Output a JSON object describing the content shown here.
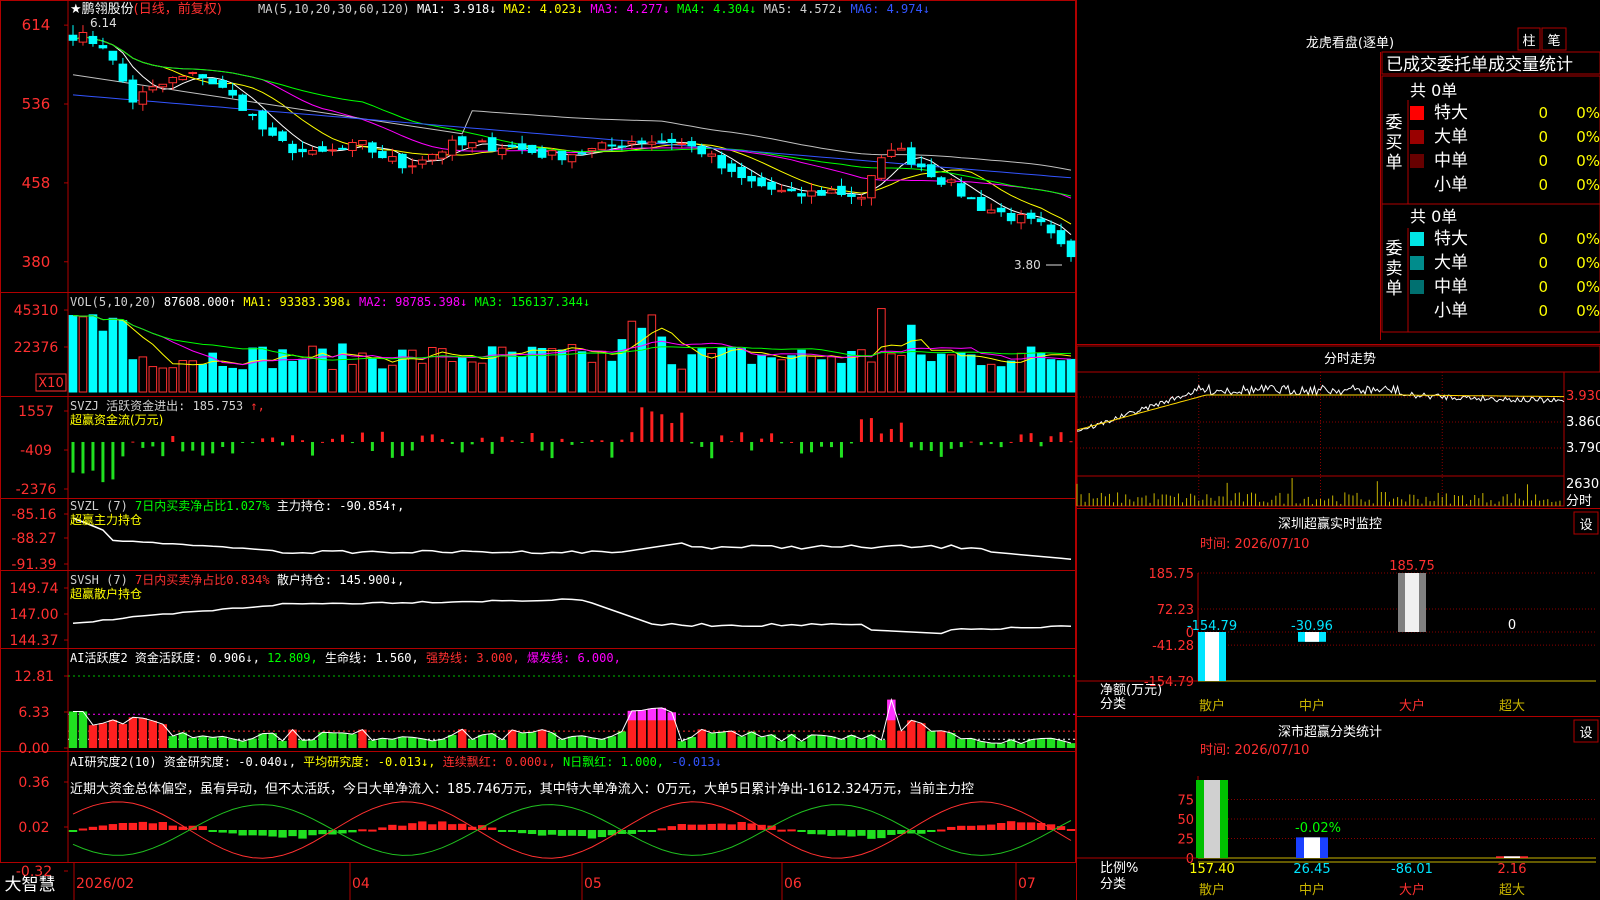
{
  "stock": {
    "title_prefix": "★",
    "name": "鹏翎股份",
    "period": "(日线，前复权)",
    "low_mark": "3.80",
    "high_mark": "6.14"
  },
  "kline": {
    "header": [
      {
        "text": "MA(5,10,20,30,60,120)",
        "color": "#d0d0d0"
      },
      {
        "text": "MA1: 3.918↓",
        "color": "#ffffff"
      },
      {
        "text": "MA2: 4.023↓",
        "color": "#ffff00"
      },
      {
        "text": "MA3: 4.277↓",
        "color": "#ff00ff"
      },
      {
        "text": "MA4: 4.304↓",
        "color": "#00ff00"
      },
      {
        "text": "MA5: 4.572↓",
        "color": "#d0d0d0"
      },
      {
        "text": "MA6: 4.974↓",
        "color": "#3355ff"
      }
    ],
    "y_ticks": [
      "614",
      "536",
      "458",
      "380"
    ],
    "ylim": [
      3.6,
      6.25
    ]
  },
  "volume": {
    "header": [
      {
        "text": "VOL(5,10,20)",
        "color": "#d0d0d0"
      },
      {
        "text": "87608.000↑",
        "color": "#ffffff"
      },
      {
        "text": "MA1: 93383.398↓",
        "color": "#ffff00"
      },
      {
        "text": "MA2: 98785.398↓",
        "color": "#ff00ff"
      },
      {
        "text": "MA3: 156137.344↓",
        "color": "#00ff00"
      }
    ],
    "y_ticks": [
      "45310",
      "22376"
    ],
    "unit": "X10"
  },
  "svzj": {
    "line1": [
      {
        "text": "SVZJ  活跃资金进出: 185.753",
        "color": "#d0d0d0"
      },
      {
        "text": "↑,",
        "color": "#ff3030"
      }
    ],
    "line2": "超赢资金流(万元)",
    "y_ticks": [
      "1557",
      "-409",
      "-2376"
    ]
  },
  "svzl": {
    "line1": [
      {
        "text": "SVZL (7)",
        "color": "#d0d0d0"
      },
      {
        "text": "7日内买卖净占比1.027%",
        "color": "#00ff00"
      },
      {
        "text": "主力持仓: -90.854↑,",
        "color": "#ffffff"
      }
    ],
    "line2": "超赢主力持仓",
    "y_ticks": [
      "-85.16",
      "-88.27",
      "-91.39"
    ]
  },
  "svsh": {
    "line1": [
      {
        "text": "SVSH (7)",
        "color": "#d0d0d0"
      },
      {
        "text": "7日内买卖净占比0.834%",
        "color": "#ff3030"
      },
      {
        "text": "散户持仓: 145.900↓,",
        "color": "#ffffff"
      }
    ],
    "line2": "超赢散户持仓",
    "y_ticks": [
      "149.74",
      "147.00",
      "144.37"
    ]
  },
  "ai1": {
    "line1": [
      {
        "text": "AI活跃度2 资金活跃度: 0.906↓,",
        "color": "#ffffff"
      },
      {
        "text": "12.809,",
        "color": "#00ff00"
      },
      {
        "text": "生命线: 1.560,",
        "color": "#ffffff"
      },
      {
        "text": "强势线: 3.000,",
        "color": "#ff3030"
      },
      {
        "text": "爆发线: 6.000,",
        "color": "#ff00ff"
      }
    ],
    "y_ticks": [
      "12.81",
      "6.33",
      "0.00"
    ]
  },
  "ai2": {
    "line1": [
      {
        "text": "AI研究度2(10) 资金研究度: -0.040↓,",
        "color": "#ffffff"
      },
      {
        "text": "平均研究度: -0.013↓,",
        "color": "#ffff00"
      },
      {
        "text": "连续飘红: 0.000↓,",
        "color": "#ff3030"
      },
      {
        "text": "N日飘红: 1.000,",
        "color": "#00ff00"
      },
      {
        "text": "-0.013↓",
        "color": "#3355ff"
      }
    ],
    "comment": "近期大资金总体偏空，虽有异动，但不太活跃，今日大单净流入：185.746万元，其中特大单净流入：0万元，大单5日累计净出-1612.324万元，当前主力控",
    "y_ticks": [
      "0.36",
      "0.02",
      "-0.32"
    ]
  },
  "x_axis": {
    "brand": "大智慧",
    "labels": [
      "2026/02",
      "04",
      "05",
      "06",
      "07"
    ]
  },
  "dragon": {
    "title": "龙虎看盘(逐单)",
    "btn1": "柱",
    "btn2": "笔",
    "subtitle": "已成交委托单成交量统计",
    "buy_label": "委买单",
    "sell_label": "委卖单",
    "buy_count": "共 0单",
    "sell_count": "共 0单",
    "buy_rows": [
      {
        "name": "特大",
        "color": "#ff0000",
        "v": "0",
        "p": "0%"
      },
      {
        "name": "大单",
        "color": "#990000",
        "v": "0",
        "p": "0%"
      },
      {
        "name": "中单",
        "color": "#660000",
        "v": "0",
        "p": "0%"
      },
      {
        "name": "小单",
        "color": "",
        "v": "0",
        "p": "0%"
      }
    ],
    "sell_rows": [
      {
        "name": "特大",
        "color": "#00e5e5",
        "v": "0",
        "p": "0%"
      },
      {
        "name": "大单",
        "color": "#008c8c",
        "v": "0",
        "p": "0%"
      },
      {
        "name": "中单",
        "color": "#007070",
        "v": "0",
        "p": "0%"
      },
      {
        "name": "小单",
        "color": "",
        "v": "0",
        "p": "0%"
      }
    ]
  },
  "intraday": {
    "title": "分时走势",
    "y_ticks": [
      "3.930",
      "3.860",
      "3.790"
    ],
    "vol_tick": "2630",
    "vol_label": "分时"
  },
  "monitor": {
    "title": "深圳超赢实时监控",
    "btn": "设",
    "time": "时间: 2026/07/10",
    "y_ticks": [
      "185.75",
      "72.23",
      "0",
      "-41.28",
      "-154.79"
    ],
    "ylabel": "净额(万元)",
    "xlabel": "分类",
    "categories": [
      "散户",
      "中户",
      "大户",
      "超大"
    ],
    "values": [
      -154.79,
      -30.96,
      185.75,
      0
    ],
    "value_labels": [
      "-154.79",
      "-30.96",
      "185.75",
      "0"
    ]
  },
  "classify": {
    "title": "深市超赢分类统计",
    "btn": "设",
    "time": "时间: 2026/07/10",
    "y_ticks": [
      "75",
      "50",
      "25",
      "0"
    ],
    "ylabel": "比例%",
    "xlabel": "分类",
    "categories": [
      "散户",
      "中户",
      "大户",
      "超大"
    ],
    "values": [
      157.4,
      26.45,
      -86.01,
      2.16
    ],
    "value_labels": [
      "157.40",
      "26.45",
      "-86.01",
      "2.16"
    ],
    "mid_label": "-0.02%"
  },
  "chart_data": [
    {
      "type": "candlestick",
      "title": "鹏翎股份 (日线，前复权)",
      "ylim": [
        3.6,
        6.25
      ],
      "low": 3.8,
      "high": 6.14,
      "y_ticks": [
        6.14,
        5.36,
        4.58,
        3.8
      ]
    },
    {
      "type": "bar",
      "title": "VOL(5,10,20)",
      "last": 87608.0,
      "ma": [
        93383.398,
        98785.398,
        156137.344
      ]
    },
    {
      "type": "bar",
      "title": "SVZJ 活跃资金进出",
      "last": 185.753
    },
    {
      "type": "line",
      "title": "SVZL 主力持仓",
      "last": -90.854
    },
    {
      "type": "line",
      "title": "SVSH 散户持仓",
      "last": 145.9
    },
    {
      "type": "bar",
      "title": "深圳超赢实时监控",
      "categories": [
        "散户",
        "中户",
        "大户",
        "超大"
      ],
      "values": [
        -154.79,
        -30.96,
        185.75,
        0
      ]
    },
    {
      "type": "bar",
      "title": "深市超赢分类统计",
      "categories": [
        "散户",
        "中户",
        "大户",
        "超大"
      ],
      "values": [
        157.4,
        26.45,
        -86.01,
        2.16
      ]
    }
  ]
}
